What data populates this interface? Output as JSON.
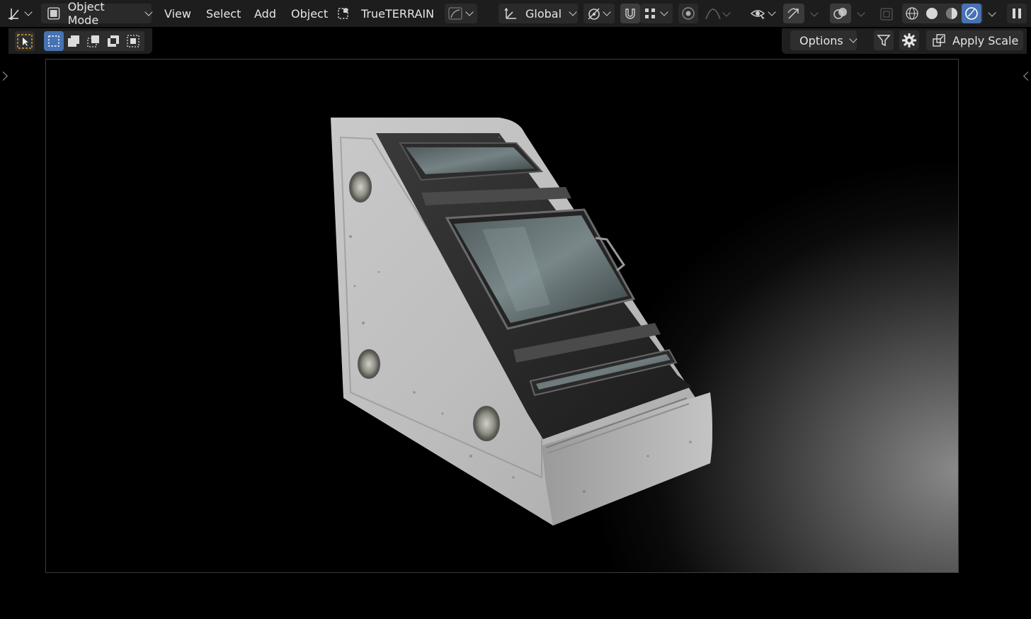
{
  "header": {
    "editor_type_icon": "axis-editor-icon",
    "mode_selector": {
      "label": "Object Mode",
      "icon": "object-mode-icon"
    },
    "menu": [
      {
        "label": "View"
      },
      {
        "label": "Select"
      },
      {
        "label": "Add"
      },
      {
        "label": "Object"
      }
    ],
    "addon_label": "TrueTERRAIN",
    "transform_orientation": "Global",
    "shading_active": "rendered",
    "colors": {
      "accent": "#4772b3",
      "header_bg": "#1d1d1d",
      "button_bg": "#2a2a2a"
    }
  },
  "tool_settings": {
    "select_modes": [
      "set",
      "extend",
      "subtract",
      "difference",
      "intersect"
    ],
    "options_label": "Options",
    "apply_scale_label": "Apply Scale"
  },
  "viewport": {
    "subject": "sci-fi console prop"
  }
}
